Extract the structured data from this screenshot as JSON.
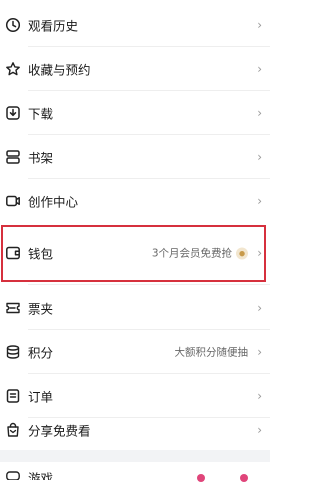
{
  "menu": {
    "items": [
      {
        "id": "history",
        "label": "观看历史",
        "icon": "clock-icon"
      },
      {
        "id": "favorites",
        "label": "收藏与预约",
        "icon": "star-icon"
      },
      {
        "id": "download",
        "label": "下载",
        "icon": "download-icon"
      },
      {
        "id": "bookshelf",
        "label": "书架",
        "icon": "bookshelf-icon"
      },
      {
        "id": "creator",
        "label": "创作中心",
        "icon": "camera-icon"
      },
      {
        "id": "wallet",
        "label": "钱包",
        "icon": "wallet-icon",
        "extra": "3个月会员免费抢"
      },
      {
        "id": "tickets",
        "label": "票夹",
        "icon": "ticket-icon"
      },
      {
        "id": "points",
        "label": "积分",
        "icon": "database-icon",
        "extra": "大额积分随便抽"
      },
      {
        "id": "orders",
        "label": "订单",
        "icon": "order-icon"
      },
      {
        "id": "share",
        "label": "分享免费看",
        "icon": "gift-bag-icon"
      }
    ],
    "partial_label": "游戏"
  },
  "colors": {
    "highlight_border": "#d6303d",
    "chevron": "#9a9a9a",
    "text": "#1a1a1a",
    "dot": "#e0457a"
  },
  "chevron_glyph": "›"
}
